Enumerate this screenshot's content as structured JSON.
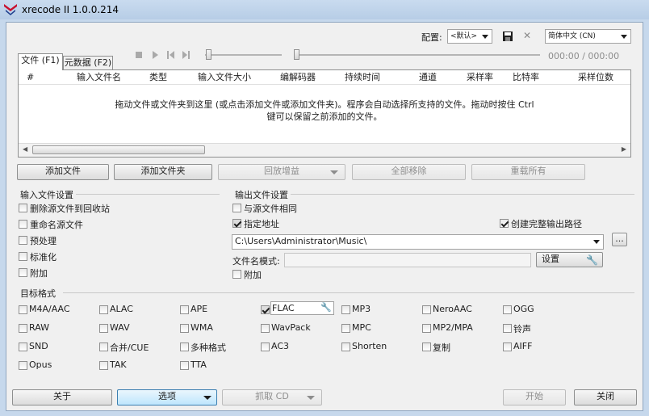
{
  "window": {
    "title": "xrecode II 1.0.0.214"
  },
  "config": {
    "label": "配置:",
    "preset": "<默认>",
    "language": "简体中文 (CN)"
  },
  "player": {
    "time": "000:00 / 000:00"
  },
  "tabs": [
    {
      "label": "文件 (F1)"
    },
    {
      "label": "元数据 (F2)"
    }
  ],
  "file_list": {
    "columns": [
      "#",
      "输入文件名",
      "类型",
      "输入文件大小",
      "编解码器",
      "持续时间",
      "通道",
      "采样率",
      "比特率",
      "采样位数"
    ],
    "empty_hint_line1": "拖动文件或文件夹到这里 (或点击添加文件或添加文件夹)。程序会自动选择所支持的文件。拖动时按住 Ctrl",
    "empty_hint_line2": "键可以保留之前添加的文件。"
  },
  "actions": {
    "add_file": "添加文件",
    "add_folder": "添加文件夹",
    "replay_gain": "回放增益",
    "remove_all": "全部移除",
    "reload_all": "重载所有"
  },
  "input_settings": {
    "title": "输入文件设置",
    "options": [
      {
        "label": "删除源文件到回收站",
        "checked": false
      },
      {
        "label": "重命名源文件",
        "checked": false
      },
      {
        "label": "预处理",
        "checked": false
      },
      {
        "label": "标准化",
        "checked": false
      },
      {
        "label": "附加",
        "checked": false
      }
    ]
  },
  "output_settings": {
    "title": "输出文件设置",
    "same_as_source": "与源文件相同",
    "specify_path": "指定地址",
    "create_full_path": "创建完整输出路径",
    "path": "C:\\Users\\Administrator\\Music\\",
    "browse": "...",
    "filename_pattern_label": "文件名模式:",
    "filename_pattern": "",
    "settings": "设置",
    "append": "附加"
  },
  "target_format": {
    "title": "目标格式",
    "formats": [
      [
        "M4A/AAC",
        "ALAC",
        "APE",
        "FLAC",
        "MP3",
        "NeroAAC",
        "OGG"
      ],
      [
        "RAW",
        "WAV",
        "WMA",
        "WavPack",
        "MPC",
        "MP2/MPA",
        "铃声"
      ],
      [
        "SND",
        "合并/CUE",
        "多种格式",
        "AC3",
        "Shorten",
        "复制",
        "AIFF"
      ],
      [
        "Opus",
        "TAK",
        "TTA"
      ]
    ],
    "selected": "FLAC"
  },
  "bottom": {
    "about": "关于",
    "options": "选项",
    "rip_cd": "抓取 CD",
    "start": "开始",
    "close": "关闭"
  },
  "colors": {
    "window_frame": "#c6d8ec",
    "panel": "#f0f0f0",
    "accent": "#3f5fa3"
  }
}
